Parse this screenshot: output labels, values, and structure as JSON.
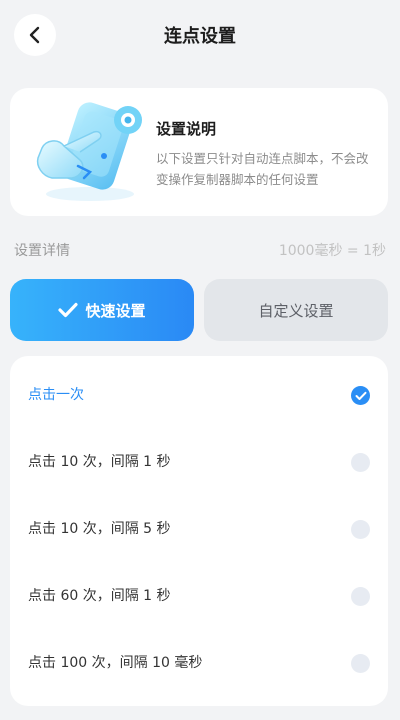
{
  "header": {
    "title": "连点设置",
    "back_icon": "chevron-left-icon"
  },
  "info": {
    "title": "设置说明",
    "description": "以下设置只针对自动连点脚本，不会改变操作复制器脚本的任何设置",
    "illustration_icon": "tap-hand-illustration"
  },
  "detail": {
    "label": "设置详情",
    "note": "1000毫秒 = 1秒"
  },
  "tabs": [
    {
      "label": "快速设置",
      "active": true,
      "icon": "checkmark-icon"
    },
    {
      "label": "自定义设置",
      "active": false
    }
  ],
  "options": [
    {
      "label": "点击一次",
      "selected": true
    },
    {
      "label": "点击 10 次，间隔 1 秒",
      "selected": false
    },
    {
      "label": "点击 10 次，间隔 5 秒",
      "selected": false
    },
    {
      "label": "点击 60 次，间隔 1 秒",
      "selected": false
    },
    {
      "label": "点击 100 次，间隔 10  毫秒",
      "selected": false
    }
  ],
  "colors": {
    "accent": "#2a8ef5",
    "accent_light": "#37b3fb",
    "background": "#f2f3f5",
    "radio_unselected": "#e7ebf2",
    "tab_inactive": "#e3e6ea"
  }
}
